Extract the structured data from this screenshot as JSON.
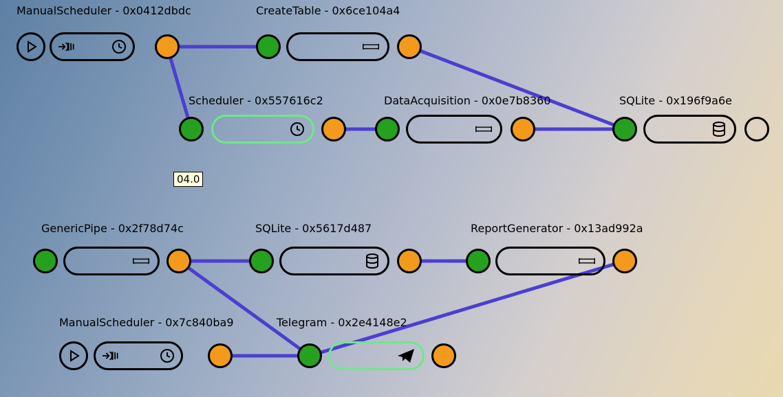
{
  "tooltip": "04.0",
  "nodes": {
    "manualScheduler1": {
      "label": "ManualScheduler - 0x0412dbdc"
    },
    "createTable": {
      "label": "CreateTable - 0x6ce104a4"
    },
    "scheduler": {
      "label": "Scheduler - 0x557616c2"
    },
    "dataAcquisition": {
      "label": "DataAcquisition - 0x0e7b8360"
    },
    "sqlite1": {
      "label": "SQLite - 0x196f9a6e"
    },
    "genericPipe": {
      "label": "GenericPipe - 0x2f78d74c"
    },
    "sqlite2": {
      "label": "SQLite - 0x5617d487"
    },
    "reportGenerator": {
      "label": "ReportGenerator - 0x13ad992a"
    },
    "manualScheduler2": {
      "label": "ManualScheduler - 0x7c840ba9"
    },
    "telegram": {
      "label": "Telegram - 0x2e4148e2"
    }
  },
  "edges": [
    {
      "from": "manualScheduler1.out",
      "to": "createTable.in"
    },
    {
      "from": "manualScheduler1.out",
      "to": "scheduler.in"
    },
    {
      "from": "createTable.out",
      "to": "sqlite1.in"
    },
    {
      "from": "scheduler.out",
      "to": "dataAcquisition.in"
    },
    {
      "from": "dataAcquisition.out",
      "to": "sqlite1.in"
    },
    {
      "from": "genericPipe.out",
      "to": "sqlite2.in"
    },
    {
      "from": "sqlite2.out",
      "to": "reportGenerator.in"
    },
    {
      "from": "genericPipe.out",
      "to": "telegram.in"
    },
    {
      "from": "reportGenerator.out",
      "to": "telegram.in"
    },
    {
      "from": "manualScheduler2.out",
      "to": "telegram.in"
    }
  ],
  "colors": {
    "edge": "#4b3fd0",
    "portInput": "#25a11f",
    "portOutput": "#f39a1c",
    "selected": "#6ee88a"
  }
}
